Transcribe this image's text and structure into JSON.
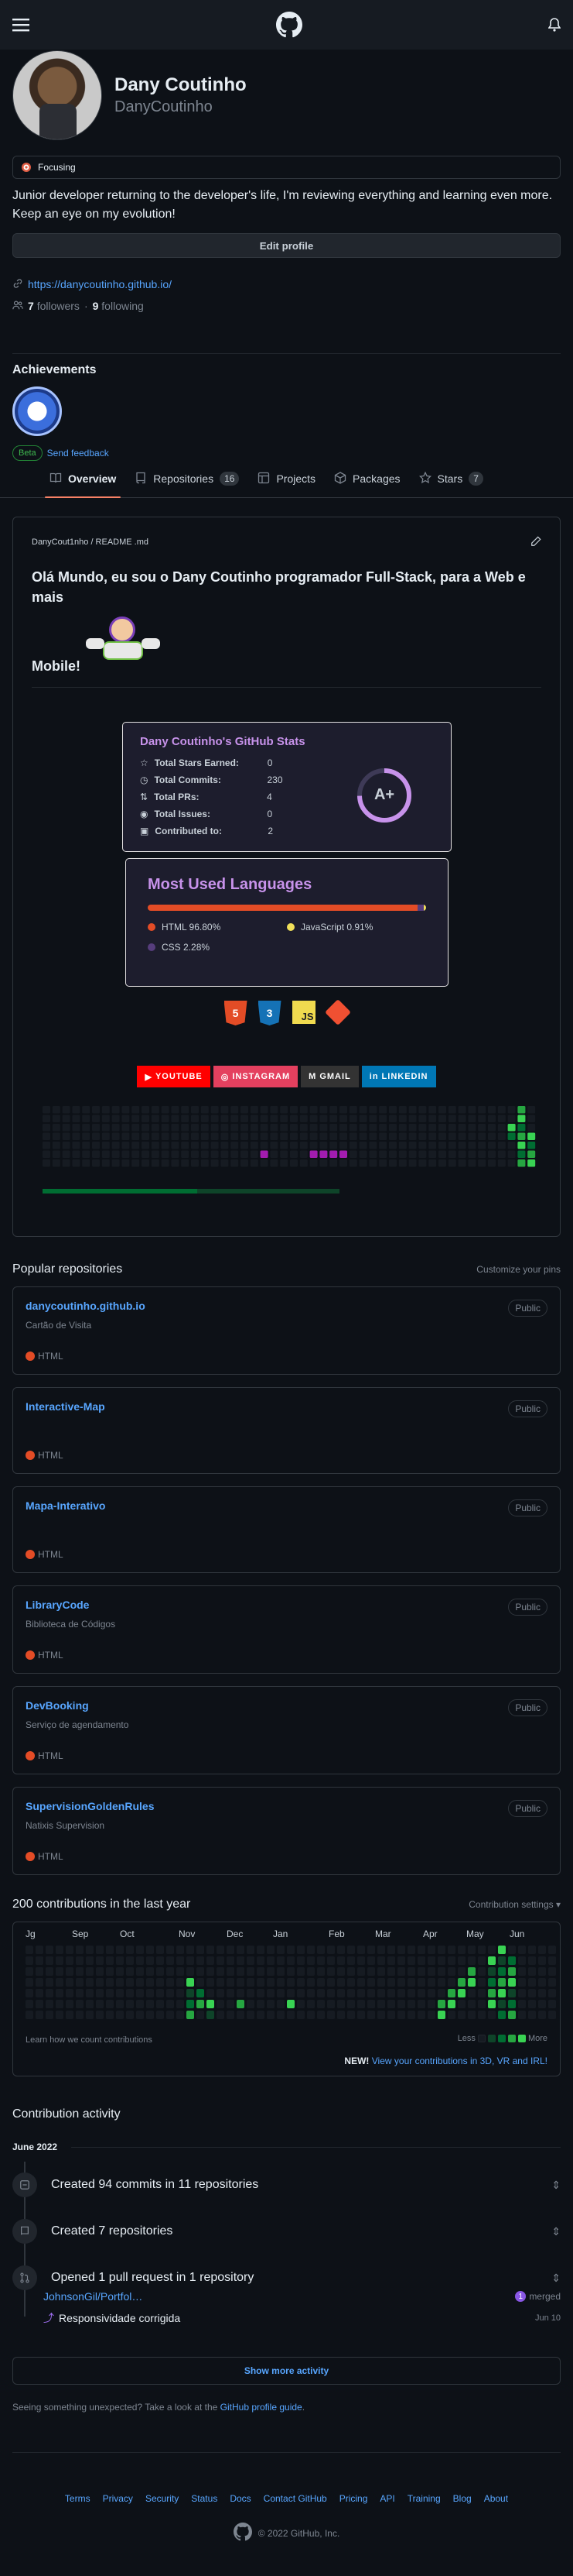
{
  "header": {
    "menu_icon": "hamburger-icon",
    "logo_icon": "github-logo-icon",
    "bell_icon": "bell-icon"
  },
  "profile": {
    "name": "Dany Coutinho",
    "login": "DanyCoutinho",
    "status": "Focusing",
    "bio": "Junior developer returning to the developer's life, I'm reviewing everything and learning even more. Keep an eye on my evolution!",
    "edit_label": "Edit profile",
    "website": "https://danycoutinho.github.io/",
    "followers_count": "7",
    "followers_label": "followers",
    "following_count": "9",
    "following_label": "following"
  },
  "achievements": {
    "title": "Achievements",
    "beta": "Beta",
    "feedback": "Send feedback"
  },
  "tabs": [
    {
      "label": "Overview",
      "count": ""
    },
    {
      "label": "Repositories",
      "count": "16"
    },
    {
      "label": "Projects",
      "count": ""
    },
    {
      "label": "Packages",
      "count": ""
    },
    {
      "label": "Stars",
      "count": "7"
    }
  ],
  "readme": {
    "path": "DanyCout1nho / README .md",
    "heading": "Olá Mundo, eu sou o Dany Coutinho programador Full-Stack, para a Web e mais",
    "heading2": "Mobile!",
    "stats": {
      "title": "Dany Coutinho's GitHub Stats",
      "rows": [
        {
          "k": "Total Stars Earned:",
          "v": "0"
        },
        {
          "k": "Total Commits:",
          "v": "230"
        },
        {
          "k": "Total PRs:",
          "v": "4"
        },
        {
          "k": "Total Issues:",
          "v": "0"
        },
        {
          "k": "Contributed to:",
          "v": "2"
        }
      ],
      "grade": "A+"
    },
    "langs": {
      "title": "Most Used Languages",
      "items": [
        {
          "label": "HTML 96.80%",
          "color": "#e34c26",
          "pct": 96.8
        },
        {
          "label": "JavaScript 0.91%",
          "color": "#f1e05a",
          "pct": 0.91
        },
        {
          "label": "CSS 2.28%",
          "color": "#563d7c",
          "pct": 2.28
        }
      ]
    },
    "tech_icons": [
      "5",
      "3",
      "JS",
      "git"
    ],
    "socials": [
      {
        "label": "YOUTUBE",
        "color": "#ff0000"
      },
      {
        "label": "INSTAGRAM",
        "color": "#e4405f"
      },
      {
        "label": "GMAIL",
        "color": "#333333"
      },
      {
        "label": "LINKEDIN",
        "color": "#0077b5"
      }
    ]
  },
  "popular": {
    "title": "Popular repositories",
    "customize": "Customize your pins",
    "repos": [
      {
        "name": "danycoutinho.github.io",
        "desc": "Cartão de Visita",
        "lang": "HTML",
        "vis": "Public"
      },
      {
        "name": "Interactive-Map",
        "desc": "",
        "lang": "HTML",
        "vis": "Public"
      },
      {
        "name": "Mapa-Interativo",
        "desc": "",
        "lang": "HTML",
        "vis": "Public"
      },
      {
        "name": "LibraryCode",
        "desc": "Biblioteca de Códigos",
        "lang": "HTML",
        "vis": "Public"
      },
      {
        "name": "DevBooking",
        "desc": "Serviço de agendamento",
        "lang": "HTML",
        "vis": "Public"
      },
      {
        "name": "SupervisionGoldenRules",
        "desc": "Natixis Supervision",
        "lang": "HTML",
        "vis": "Public"
      }
    ]
  },
  "contrib": {
    "title": "200 contributions in the last year",
    "settings": "Contribution settings",
    "months": [
      "Jg",
      "Sep",
      "Oct",
      "Nov",
      "Dec",
      "Jan",
      "Feb",
      "Mar",
      "Apr",
      "May",
      "Jun"
    ],
    "learn": "Learn how we count contributions",
    "less": "Less",
    "more": "More",
    "new_label": "NEW!",
    "new_link": "View your contributions in 3D, VR and IRL!"
  },
  "activity": {
    "title": "Contribution activity",
    "month": "June 2022",
    "items": [
      "Created 94 commits in 11 repositories",
      "Created 7 repositories",
      "Opened 1 pull request in 1 repository"
    ],
    "pr_repo": "JohnsonGil/Portfol…",
    "pr_count": "1",
    "pr_state": "merged",
    "pr_title": "Responsividade corrigida",
    "pr_date": "Jun 10",
    "show_more": "Show more activity",
    "unexpected": "Seeing something unexpected? Take a look at the",
    "guide": "GitHub profile guide",
    "period": "."
  },
  "footer": {
    "links": [
      "Terms",
      "Privacy",
      "Security",
      "Status",
      "Docs",
      "Contact GitHub",
      "Pricing",
      "API",
      "Training",
      "Blog",
      "About"
    ],
    "copyright": "© 2022 GitHub, Inc."
  }
}
